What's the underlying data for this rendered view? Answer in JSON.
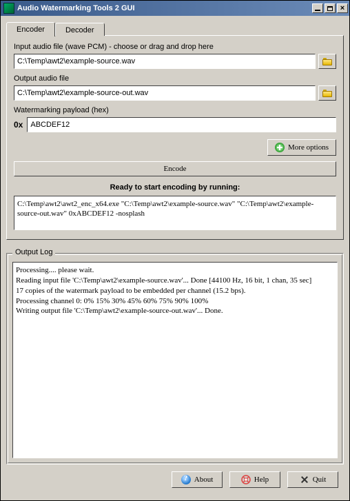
{
  "window": {
    "title": "Audio Watermarking Tools 2 GUI"
  },
  "tabs": {
    "encoder": "Encoder",
    "decoder": "Decoder"
  },
  "encoder": {
    "input_label": "Input audio file (wave PCM) - choose or drag and drop here",
    "input_value": "C:\\Temp\\awt2\\example-source.wav",
    "output_label": "Output audio file",
    "output_value": "C:\\Temp\\awt2\\example-source-out.wav",
    "payload_label": "Watermarking payload (hex)",
    "payload_prefix": "0x",
    "payload_value": "ABCDEF12",
    "more_options": "More options",
    "encode_button": "Encode",
    "status_label": "Ready to start encoding by running:",
    "command": "C:\\Temp\\awt2\\awt2_enc_x64.exe \"C:\\Temp\\awt2\\example-source.wav\" \"C:\\Temp\\awt2\\example-source-out.wav\" 0xABCDEF12 -nosplash"
  },
  "output_log": {
    "title": "Output Log",
    "content": "Processing.... please wait.\nReading input file 'C:\\Temp\\awt2\\example-source.wav'... Done [44100 Hz, 16 bit, 1 chan, 35 sec]\n17 copies of the watermark payload to be embedded per channel (15.2 bps).\nProcessing channel 0: 0% 15% 30% 45% 60% 75% 90% 100%\nWriting output file 'C:\\Temp\\awt2\\example-source-out.wav'... Done."
  },
  "buttons": {
    "about": "About",
    "help": "Help",
    "quit": "Quit"
  }
}
